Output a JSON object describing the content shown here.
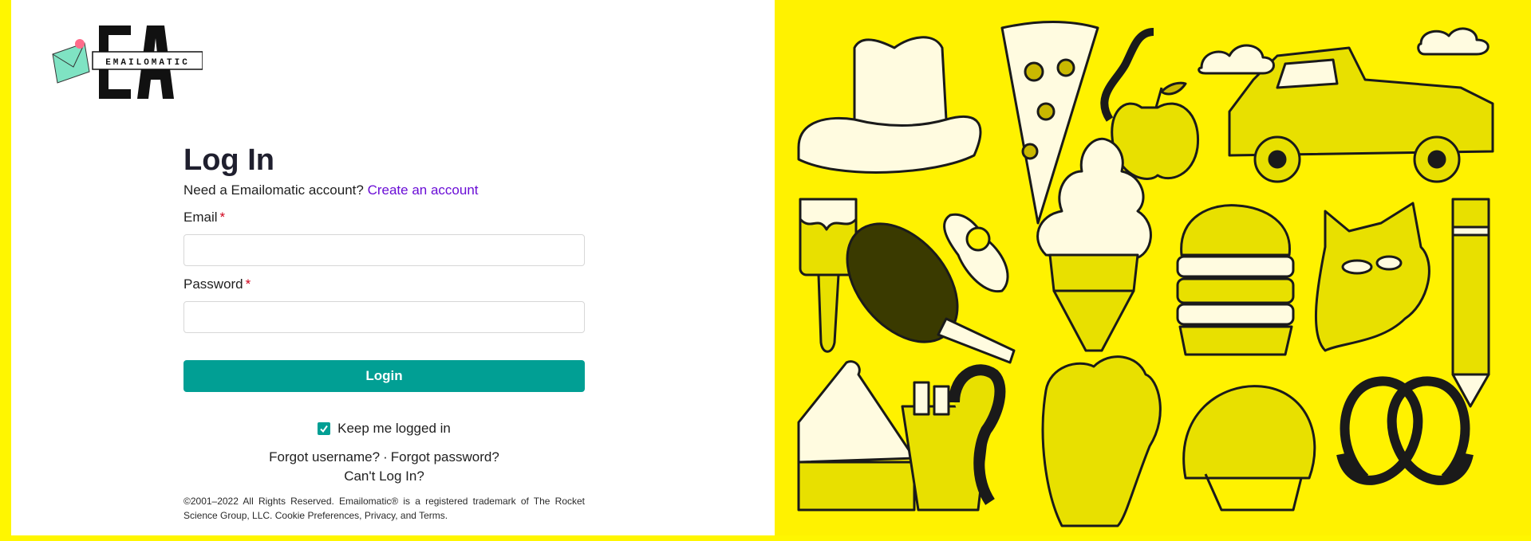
{
  "logo": {
    "monogram": "EA",
    "wordmark": "EMAILOMATIC"
  },
  "login": {
    "title": "Log In",
    "prompt": "Need a Emailomatic account?",
    "create_link": "Create an account",
    "email_label": "Email",
    "password_label": "Password",
    "required_marker": "*",
    "email_value": "",
    "password_value": "",
    "button_label": "Login",
    "keep_logged_in_label": "Keep me logged in",
    "keep_logged_in_checked": true,
    "forgot_username": "Forgot username?",
    "separator": "·",
    "forgot_password": "Forgot password?",
    "cant_login": "Can't Log In?"
  },
  "legal": {
    "text": "©2001–2022 All Rights Reserved. Emailomatic® is a registered trademark of The Rocket Science Group, LLC.",
    "cookie_link": "Cookie Preferences",
    "privacy_link": "Privacy",
    "and": ", and",
    "terms_link": "Terms"
  },
  "colors": {
    "accent": "#019f94",
    "link": "#6a0dd6",
    "illustration_bg": "#FFF200",
    "required": "#d0021b"
  }
}
